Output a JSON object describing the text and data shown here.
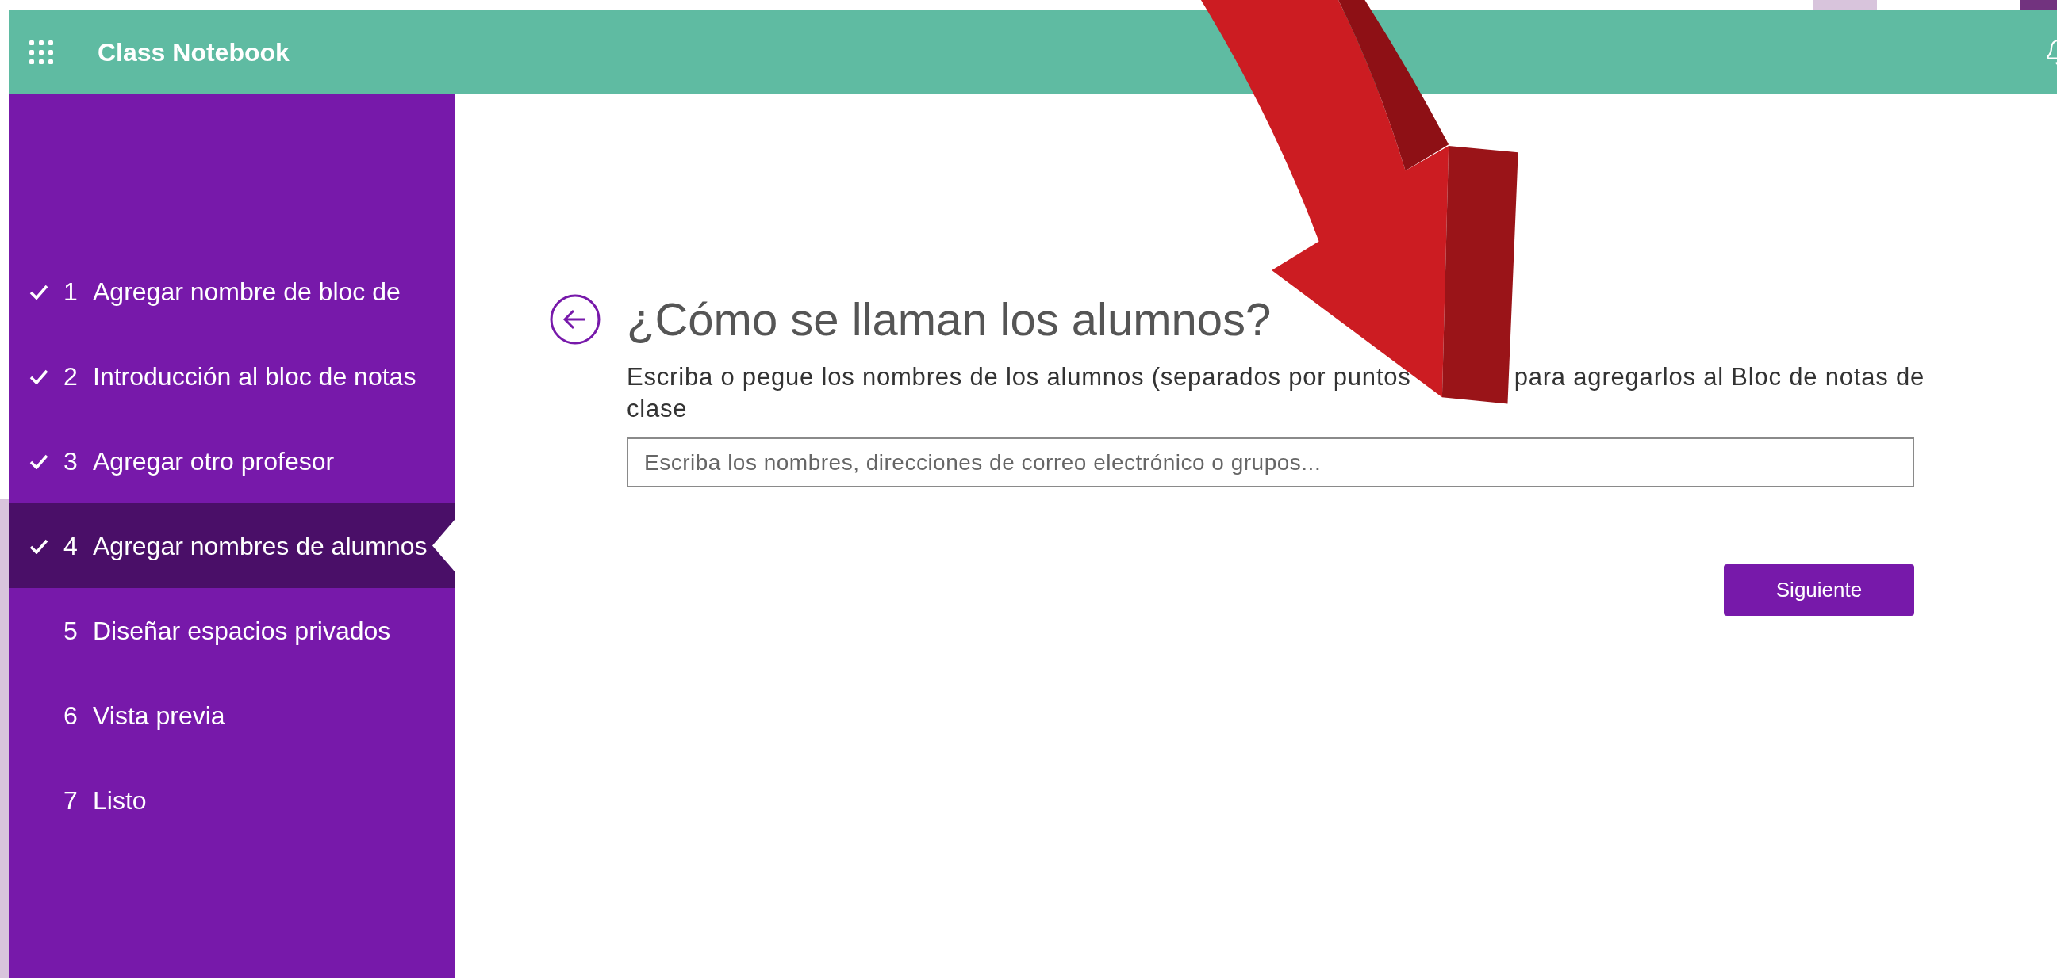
{
  "app": {
    "title": "Class Notebook"
  },
  "steps": [
    {
      "number": "1",
      "label": "Agregar nombre de bloc de",
      "done": true,
      "selected": false
    },
    {
      "number": "2",
      "label": "Introducción al bloc de notas",
      "done": true,
      "selected": false
    },
    {
      "number": "3",
      "label": "Agregar otro profesor",
      "done": true,
      "selected": false
    },
    {
      "number": "4",
      "label": "Agregar nombres de alumnos",
      "done": true,
      "selected": true
    },
    {
      "number": "5",
      "label": "Diseñar espacios privados",
      "done": false,
      "selected": false
    },
    {
      "number": "6",
      "label": "Vista previa",
      "done": false,
      "selected": false
    },
    {
      "number": "7",
      "label": "Listo",
      "done": false,
      "selected": false
    }
  ],
  "page": {
    "heading": "¿Cómo se llaman los alumnos?",
    "description_parts": [
      "Escriba o pegue los nombres de los alumnos (separados por puntos",
      "para agregarlos al Bloc de notas de",
      "clase"
    ],
    "input": {
      "placeholder": "Escriba los nombres, direcciones de correo electrónico o grupos..."
    },
    "button": "Siguiente"
  }
}
